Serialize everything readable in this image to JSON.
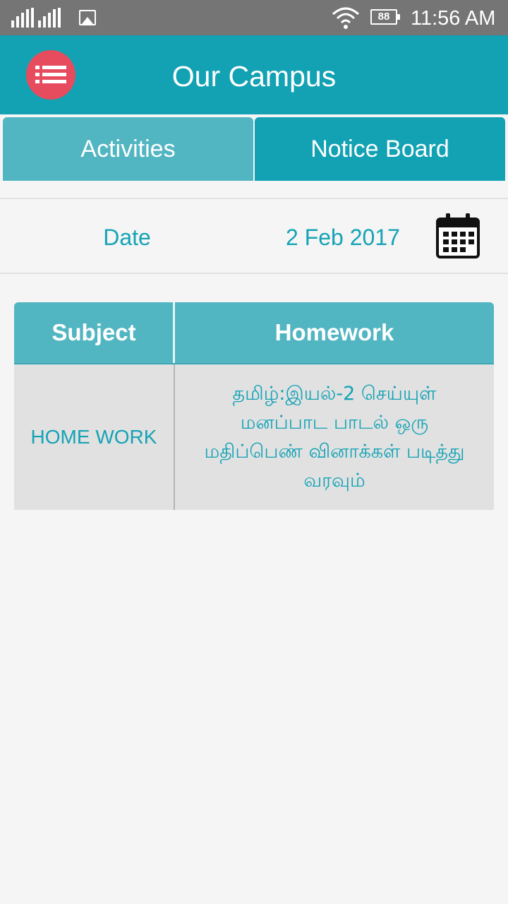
{
  "status_bar": {
    "time": "11:56 AM",
    "battery_level": "88",
    "icons": [
      "signal-icon",
      "signal-icon",
      "gallery-icon",
      "wifi-icon",
      "battery-icon"
    ]
  },
  "app_bar": {
    "title": "Our Campus",
    "menu_icon": "list-menu-icon",
    "menu_color": "#e64c5e",
    "bar_color": "#12a2b4"
  },
  "tabs": [
    {
      "label": "Activities",
      "selected": false
    },
    {
      "label": "Notice Board",
      "selected": true
    }
  ],
  "date_row": {
    "label": "Date",
    "value": "2 Feb 2017",
    "icon": "calendar-icon"
  },
  "table": {
    "headers": [
      "Subject",
      "Homework"
    ],
    "rows": [
      {
        "subject": "HOME WORK",
        "homework": "தமிழ்:இயல்-2 செய்யுள் மனப்பாட பாடல் ஒரு மதிப்பெண் வினாக்கள் படித்து வரவும்"
      }
    ]
  }
}
